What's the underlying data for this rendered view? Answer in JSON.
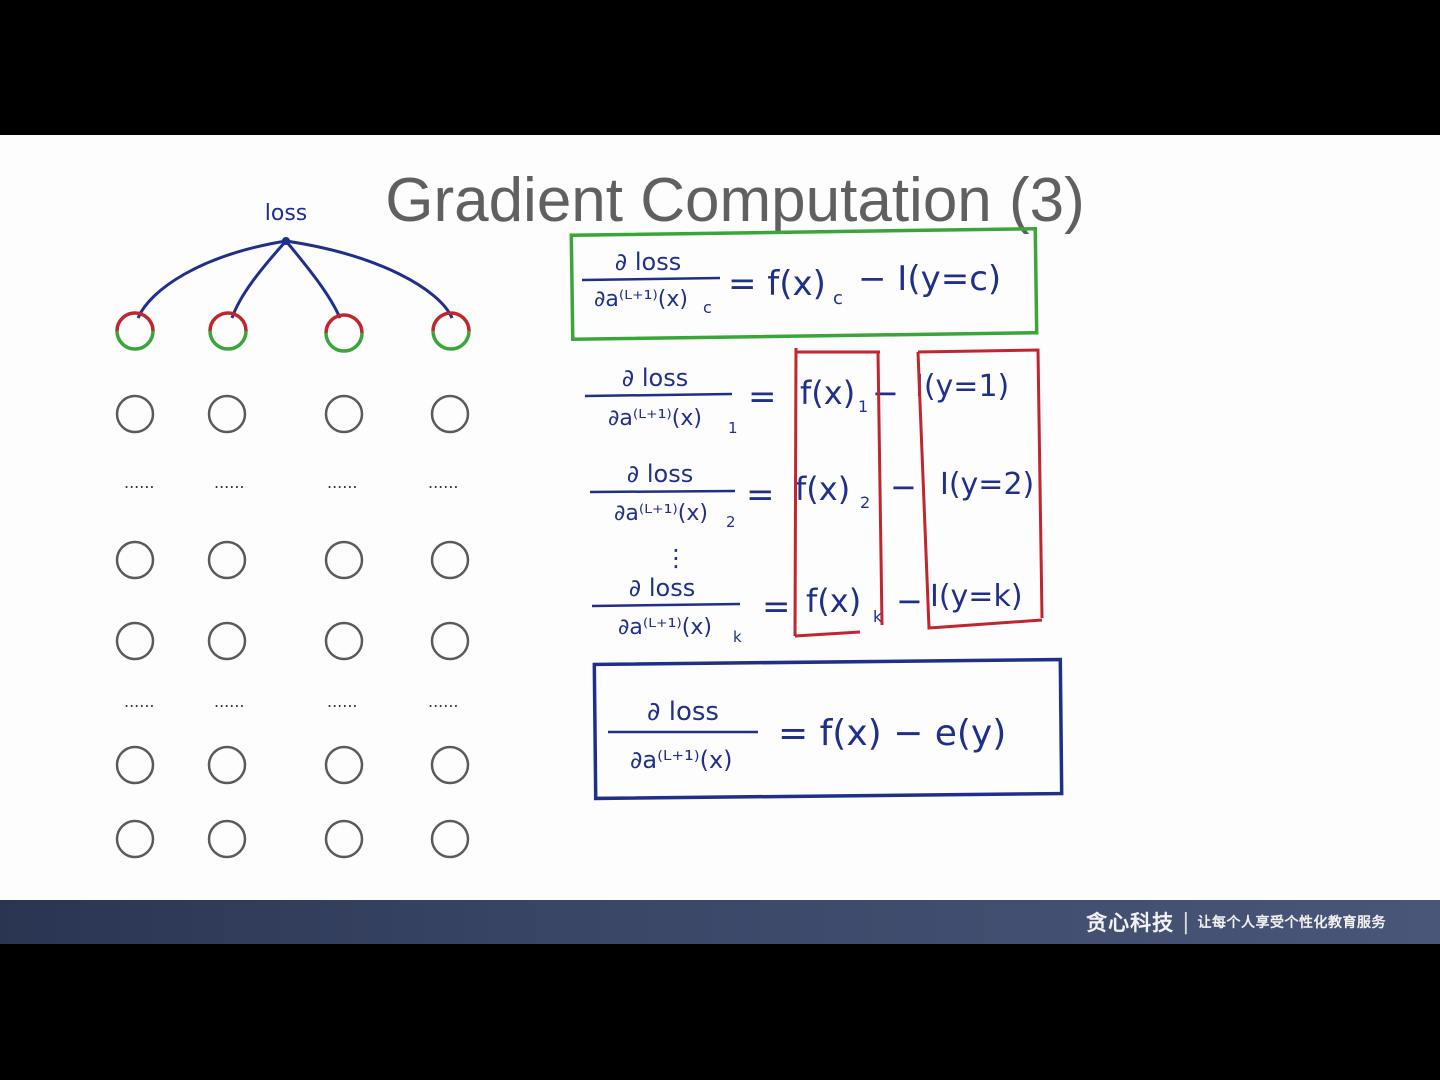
{
  "slide": {
    "title": "Gradient Computation (3)"
  },
  "network": {
    "top_label": "loss",
    "columns": 4,
    "node_rows": 6,
    "dots": "......"
  },
  "equations": {
    "top": {
      "numerator": "∂ loss",
      "denominator": "∂a⁽ᴸ⁺¹⁾(x)",
      "denominator_sub": "c",
      "rhs": "= f(x)",
      "rhs_sub": "c",
      "rhs_tail": "− I(y=c)"
    },
    "rows": [
      {
        "numerator": "∂ loss",
        "denominator": "∂a⁽ᴸ⁺¹⁾(x)",
        "sub": "1",
        "equals": "=",
        "f": "f(x)",
        "f_sub": "1",
        "minus": "−",
        "indicator": "I(y=1)"
      },
      {
        "numerator": "∂ loss",
        "denominator": "∂a⁽ᴸ⁺¹⁾(x)",
        "sub": "2",
        "equals": "=",
        "f": "f(x)",
        "f_sub": "2",
        "minus": "−",
        "indicator": "I(y=2)"
      },
      {
        "numerator": "∂ loss",
        "denominator": "∂a⁽ᴸ⁺¹⁾(x)",
        "sub": "k",
        "equals": "=",
        "f": "f(x)",
        "f_sub": "k",
        "minus": "−",
        "indicator": "I(y=k)"
      }
    ],
    "vdots": "⋮",
    "result": {
      "numerator": "∂ loss",
      "denominator": "∂a⁽ᴸ⁺¹⁾(x)",
      "rhs": "= f(x) − e(y)"
    }
  },
  "footer": {
    "brand": "贪心科技",
    "separator": "|",
    "slogan": "让每个人享受个性化教育服务"
  },
  "colors": {
    "ink_blue": "#1f2f8a",
    "red": "#c0262e",
    "green": "#3aa63a",
    "node_gray": "#5a5a5a",
    "title_gray": "#606060"
  }
}
